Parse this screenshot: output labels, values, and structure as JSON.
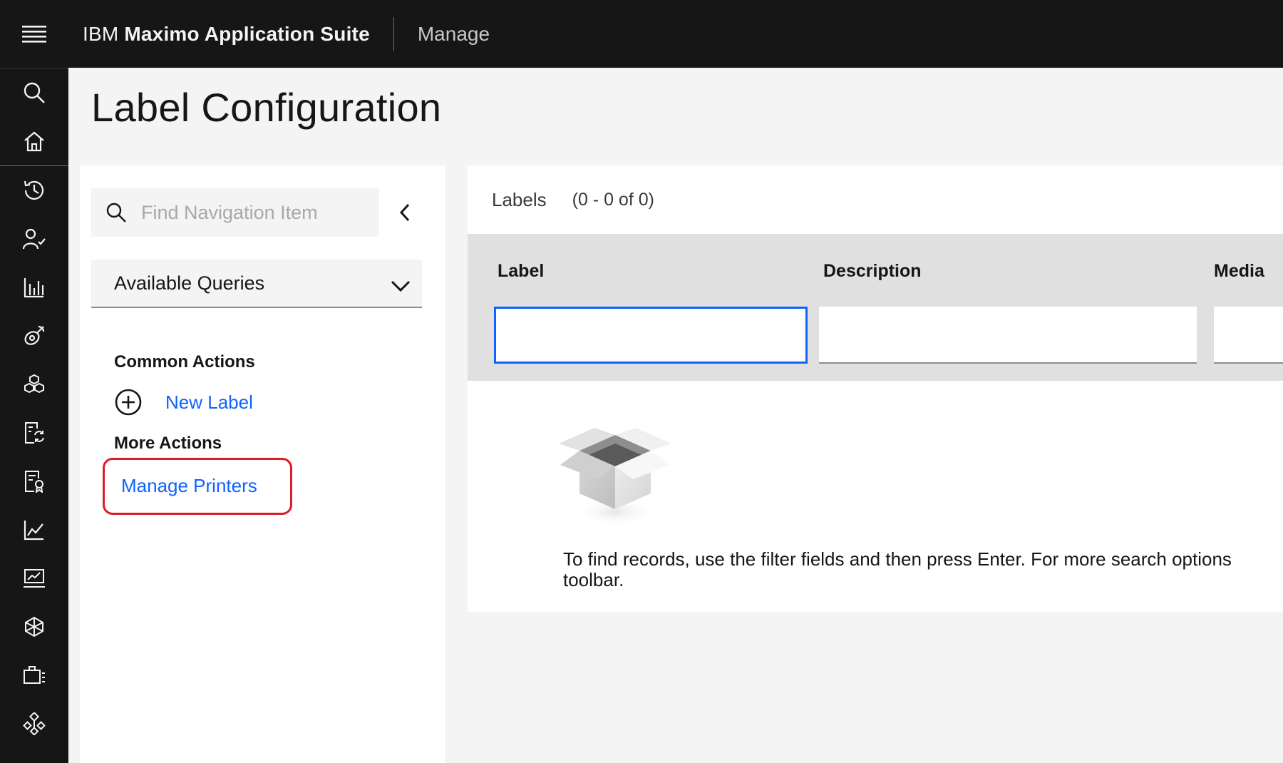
{
  "header": {
    "brand_prefix": "IBM",
    "brand_name": "Maximo Application Suite",
    "app_name": "Manage"
  },
  "rail": {
    "icons": [
      "search-icon",
      "home-icon",
      "history-icon",
      "user-check-icon",
      "bar-chart-icon",
      "satellite-icon",
      "cubes-icon",
      "document-sync-icon",
      "document-certificate-icon",
      "line-chart-icon",
      "presentation-icon",
      "hexagon-network-icon",
      "toolkit-icon",
      "hierarchy-icon"
    ]
  },
  "page": {
    "title": "Label Configuration"
  },
  "nav": {
    "search_placeholder": "Find Navigation Item",
    "queries_label": "Available Queries",
    "common_actions_heading": "Common Actions",
    "new_label": "New Label",
    "more_actions_heading": "More Actions",
    "manage_printers": "Manage Printers"
  },
  "table": {
    "title": "Labels",
    "count": "(0 - 0 of 0)",
    "columns": [
      "Label",
      "Description",
      "Media"
    ],
    "empty_message_line1": "To find records, use the filter fields and then press Enter. For more search options",
    "empty_message_line2": "toolbar."
  },
  "colors": {
    "header_bg": "#161616",
    "link": "#0f62fe",
    "focus": "#0f62fe",
    "highlight": "#da1e28"
  }
}
